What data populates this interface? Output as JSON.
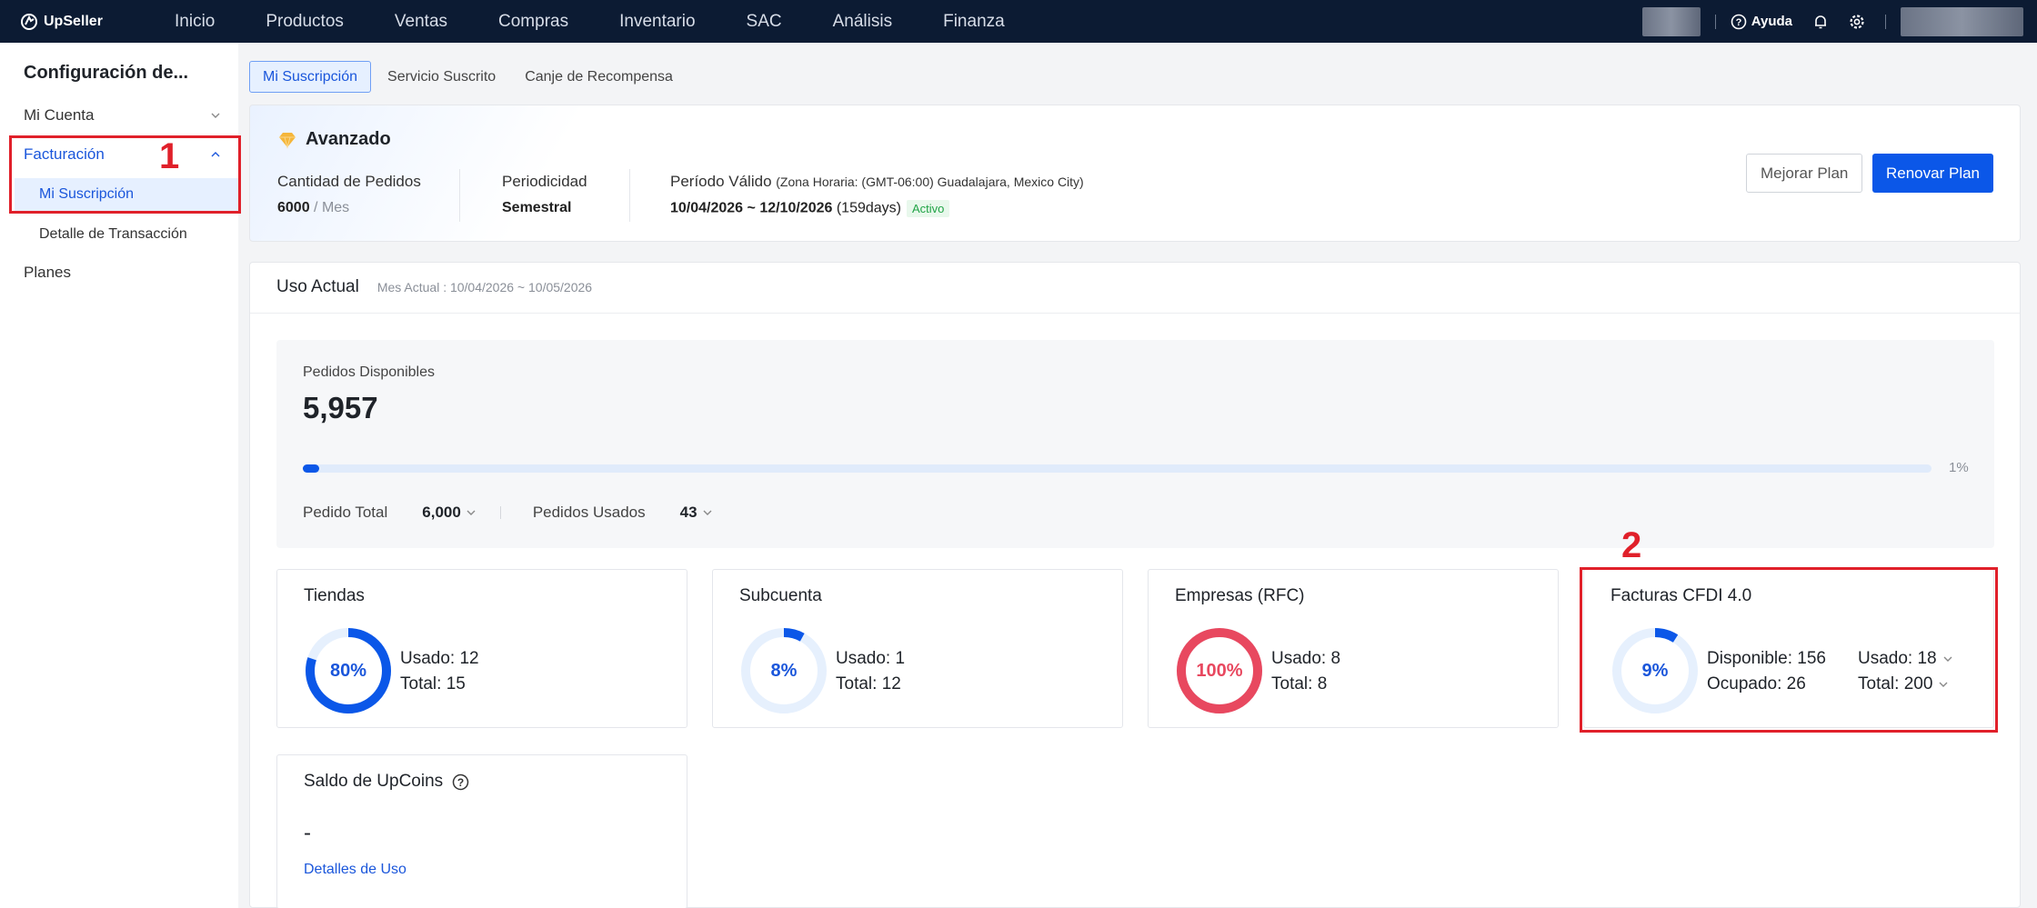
{
  "nav": {
    "brand": "UpSeller",
    "items": [
      "Inicio",
      "Productos",
      "Ventas",
      "Compras",
      "Inventario",
      "SAC",
      "Análisis",
      "Finanza"
    ],
    "help_label": "Ayuda"
  },
  "sidebar": {
    "title": "Configuración de...",
    "items": {
      "mi_cuenta": "Mi Cuenta",
      "facturacion": "Facturación",
      "mi_suscripcion": "Mi Suscripción",
      "detalle_transaccion": "Detalle de Transacción",
      "planes": "Planes"
    }
  },
  "annotations": {
    "one": "1",
    "two": "2"
  },
  "tabs": [
    "Mi Suscripción",
    "Servicio Suscrito",
    "Canje de Recompensa"
  ],
  "plan": {
    "name": "Avanzado",
    "orders_label": "Cantidad de Pedidos",
    "orders_value": "6000",
    "orders_unit": "/ Mes",
    "period_label": "Periodicidad",
    "period_value": "Semestral",
    "valid_label": "Período Válido",
    "valid_tz": "(Zona Horaria: (GMT-06:00) Guadalajara, Mexico City)",
    "valid_range": "10/04/2026 ~ 12/10/2026",
    "valid_days": "(159days)",
    "status": "Activo",
    "upgrade_label": "Mejorar Plan",
    "renew_label": "Renovar Plan"
  },
  "usage": {
    "title": "Uso Actual",
    "month": "Mes Actual : 10/04/2026 ~ 10/05/2026",
    "available_label": "Pedidos Disponibles",
    "available_value": "5,957",
    "progress": 0.01,
    "progress_label": "1%",
    "total_label": "Pedido Total",
    "total_value": "6,000",
    "used_label": "Pedidos Usados",
    "used_value": "43"
  },
  "cards": [
    {
      "title": "Tiendas",
      "percent": 0.8,
      "percent_label": "80%",
      "line1": "Usado: 12",
      "line2": "Total: 15",
      "color": "#0b57e8"
    },
    {
      "title": "Subcuenta",
      "percent": 0.08,
      "percent_label": "8%",
      "line1": "Usado: 1",
      "line2": "Total: 12",
      "color": "#0b57e8"
    },
    {
      "title": "Empresas (RFC)",
      "percent": 1.0,
      "percent_label": "100%",
      "line1": "Usado: 8",
      "line2": "Total: 8",
      "color": "#e8485f"
    },
    {
      "title": "Facturas CFDI 4.0",
      "percent": 0.09,
      "percent_label": "9%",
      "line1": "Disponible: 156",
      "line2": "Ocupado: 26",
      "line3": "Usado: 18",
      "line4": "Total: 200",
      "color": "#0b57e8"
    }
  ],
  "upcoins": {
    "title": "Saldo de UpCoins",
    "value": "-",
    "link": "Detalles de Uso"
  },
  "colors": {
    "primary": "#0b57e8",
    "danger": "#e8485f",
    "annotation": "#e0202a",
    "navbar": "#0c1b33"
  }
}
